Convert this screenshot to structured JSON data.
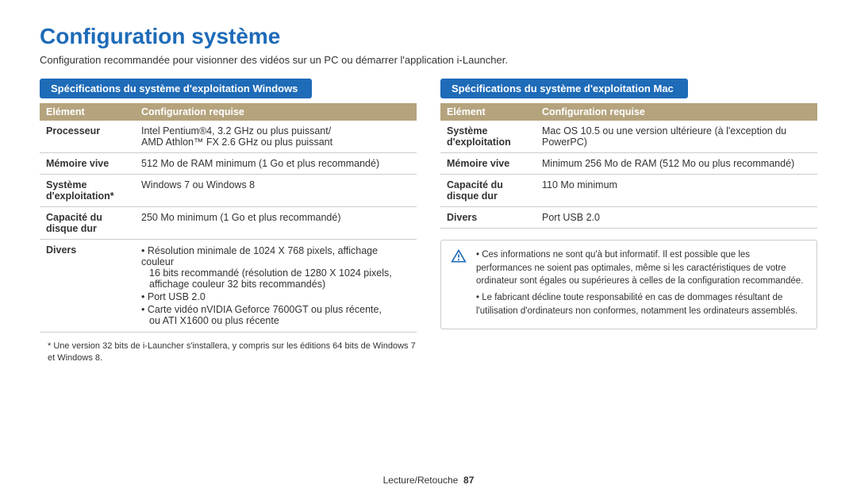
{
  "title": "Configuration système",
  "subtitle": "Configuration recommandée pour visionner des vidéos sur un PC ou démarrer l'application i-Launcher.",
  "cols": {
    "element": "Elément",
    "required": "Configuration requise"
  },
  "windows": {
    "header": "Spécifications du système d'exploitation Windows",
    "rows": {
      "cpu_label": "Processeur",
      "cpu_line1": "Intel Pentium®4, 3.2 GHz ou plus puissant/",
      "cpu_line2": "AMD Athlon™ FX 2.6 GHz ou plus puissant",
      "ram_label": "Mémoire vive",
      "ram_value": "512 Mo de RAM minimum (1 Go et plus recommandé)",
      "os_label": "Système d'exploitation*",
      "os_value": "Windows 7 ou Windows 8",
      "hdd_label": "Capacité du disque dur",
      "hdd_value": "250 Mo minimum (1 Go et plus recommandé)",
      "misc_label": "Divers",
      "misc1a": "Résolution minimale de 1024 X 768 pixels, affichage couleur",
      "misc1b": "16 bits recommandé (résolution de 1280 X 1024 pixels,",
      "misc1c": "affichage couleur 32 bits recommandés)",
      "misc2": "Port USB 2.0",
      "misc3a": "Carte vidéo nVIDIA Geforce 7600GT ou plus récente,",
      "misc3b": "ou ATI X1600 ou plus récente"
    },
    "footnote": "*  Une version 32 bits de i-Launcher s'installera, y compris sur les éditions 64 bits de Windows 7 et Windows 8."
  },
  "mac": {
    "header": "Spécifications du système d'exploitation Mac",
    "rows": {
      "os_label": "Système d'exploitation",
      "os_value": "Mac OS 10.5 ou une version ultérieure (à l'exception du PowerPC)",
      "ram_label": "Mémoire vive",
      "ram_value": "Minimum 256 Mo de RAM (512 Mo ou plus recommandé)",
      "hdd_label": "Capacité du disque dur",
      "hdd_value": "110 Mo minimum",
      "misc_label": "Divers",
      "misc_value": "Port USB 2.0"
    },
    "info": {
      "note1": "Ces informations ne sont qu'à but informatif. Il est possible que les performances ne soient pas optimales, même si les caractéristiques de votre ordinateur sont égales ou supérieures à celles de la configuration recommandée.",
      "note2": "Le fabricant décline toute responsabilité en cas de dommages résultant de l'utilisation d'ordinateurs non conformes, notamment les ordinateurs assemblés."
    }
  },
  "footer": {
    "section": "Lecture/Retouche",
    "page": "87"
  }
}
